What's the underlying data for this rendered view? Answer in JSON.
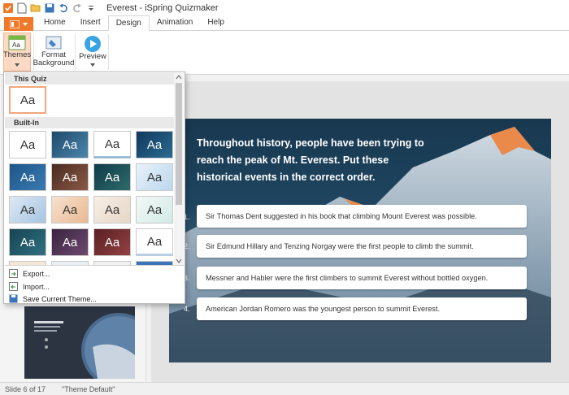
{
  "window": {
    "title": "Everest - iSpring Quizmaker"
  },
  "quick_access": {
    "undo_icon": "undo-icon",
    "redo_icon": "redo-icon",
    "save_icon": "save-icon",
    "open_icon": "open-folder-icon",
    "new_icon": "new-file-icon",
    "customize_icon": "customize-arrow-icon"
  },
  "ribbon": {
    "tabs": [
      {
        "label": "Home",
        "active": false
      },
      {
        "label": "Insert",
        "active": false
      },
      {
        "label": "Design",
        "active": true
      },
      {
        "label": "Animation",
        "active": false
      },
      {
        "label": "Help",
        "active": false
      }
    ],
    "buttons": {
      "themes": "Themes",
      "format_background_line1": "Format",
      "format_background_line2": "Background",
      "preview": "Preview"
    }
  },
  "themes_dropdown": {
    "section_this_quiz": "This Quiz",
    "section_built_in": "Built-In",
    "sample": "Aa",
    "actions": [
      "Export...",
      "Import...",
      "Save Current Theme..."
    ]
  },
  "slide": {
    "question": "Throughout history, people have been trying to reach the peak of Mt. Everest. Put these historical events in the correct order.",
    "answers": [
      {
        "num": "1.",
        "text": "Sir Thomas Dent suggested in his book that climbing Mount Everest was possible."
      },
      {
        "num": "2.",
        "text": "Sir Edmund Hillary and Tenzing Norgay were the first people to climb the summit."
      },
      {
        "num": "3.",
        "text": "Messner and Habler were the first climbers to summit Everest without bottled oxygen."
      },
      {
        "num": "4.",
        "text": "American Jordan Romero was the youngest person to summit Everest."
      }
    ]
  },
  "status_bar": {
    "slide_info": "Slide 6 of 17",
    "theme_info": "\"Theme Default\""
  },
  "colors": {
    "accent": "#f0792b",
    "theme_selected_bg": "#fbd9c4"
  }
}
